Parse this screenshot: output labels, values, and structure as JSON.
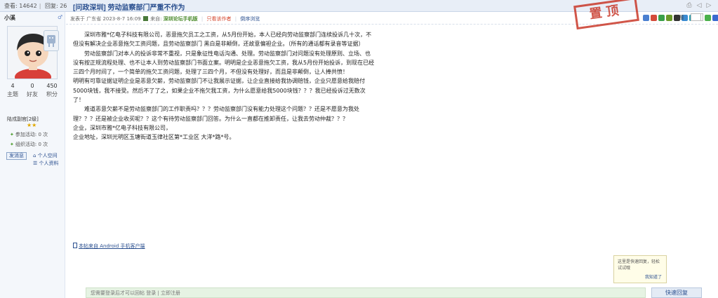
{
  "stats": {
    "views_label": "查看",
    "views": "14642",
    "replies_label": "回复",
    "replies": "26"
  },
  "thread": {
    "title": "[问政深圳] 劳动监察部门严重不作为"
  },
  "author": {
    "name": "小溪",
    "counts": [
      {
        "value": "4",
        "label": "主题"
      },
      {
        "value": "0",
        "label": "好友"
      },
      {
        "value": "450",
        "label": "积分"
      }
    ],
    "rank": "陆戎副官[2级]",
    "stars": "★★",
    "joined_events": "参加活动: 0 次",
    "organized_events": "组织活动: 0 次",
    "message_button": "发消息",
    "space_link": "个人空间",
    "profile_link": "个人资料"
  },
  "post": {
    "posted": "发表于 广东省 2023-8-7 16:09",
    "from_label": "来自:",
    "from": "深圳论坛手机版",
    "author_only": "只看该作者",
    "reverse": "倒序浏览",
    "stamp": "置顶",
    "font_label": "主题",
    "paragraphs": [
      "　　深圳市雅*亿电子科技有限公司，恶意拖欠员工之工资，从5月份开始，本人已经向劳动监察部门连续投诉几十次，不但没有解决企业恶意拖欠工资问题，且劳动监察部门 黑白是非颠倒，还故意偏袒企业。（所有的通话都有录音等证据）",
      "　　劳动监察部门对本人的投诉非常不重视，只是象征性电话沟通、处理。劳动监察部门对问题没有处理原则、立场、也没有按正规流程处理、也不让本人到劳动监察部门书面立案。明明是企业恶意拖欠工资，我从5月份开始投诉，到现在已经三四个月时间了，一个简单的拖欠工资问题，处理了三四个月，不但没有处理好，而且是非颠倒，让人捧共愤！",
      "明明有可靠证据证明企业是恶意欠薪，劳动监察部门不让我展示证据，让企业直接给我协调赔钱，企业只愿意给我赔付5000块钱，我不接受。然后不了了之，如果企业不拖欠我工资，为什么愿意给我5000块钱？？？我已经投诉过无数次了！",
      "　　难道恶意欠薪不是劳动监察部门的工作职责吗？？？劳动监察部门没有能力处理这个问题？？还是不愿意为我处理？？？还是被企业收买呢？？这个有待劳动监察部门回答。为什么一直都在推卸责任，让我去劳动仲裁？？？",
      "企业，深圳市雅*亿电子科技有限公司，",
      "企业地址，深圳光明区玉塘街道玉律社区第*工业区 大洋*路*号。"
    ],
    "client_link": "本帖来自 Android 手机客户端"
  },
  "tooltip": {
    "text": "这里是快速回复，轻松试试哦",
    "ok": "我知道了"
  },
  "reply": {
    "placeholder": "您需要登录后才可以回帖 登录 | 立即注册",
    "button": "快速回复"
  },
  "colors": {
    "accent": "#2a4f8f",
    "stamp": "#c9392a",
    "reply_bg": "#e6f3e3"
  }
}
